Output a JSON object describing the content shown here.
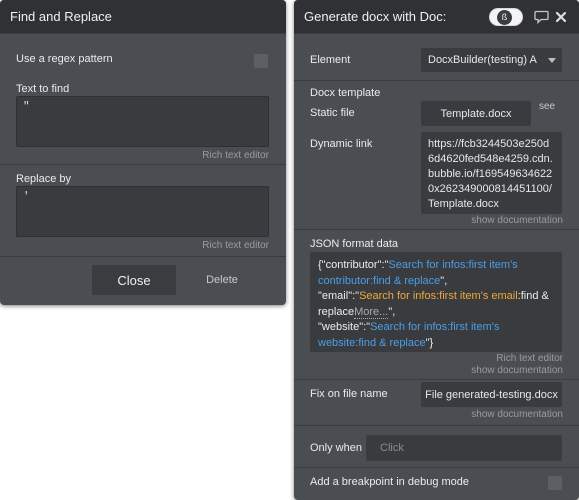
{
  "find_replace": {
    "title": "Find and Replace",
    "regex_label": "Use a regex pattern",
    "regex_checked": false,
    "find_label": "Text to find",
    "find_value": "\"",
    "find_hint": "Rich text editor",
    "replace_label": "Replace by",
    "replace_value": "'",
    "replace_hint": "Rich text editor",
    "close_label": "Close",
    "delete_label": "Delete"
  },
  "generate_docx": {
    "title": "Generate docx with Doc:",
    "avatar_glyph": "ß",
    "element_label": "Element",
    "element_value": "DocxBuilder(testing) A",
    "docx_template_label": "Docx template",
    "static_file_label": "Static file",
    "static_file_value": "Template.docx",
    "see_label": "see",
    "dynamic_link_label": "Dynamic link",
    "dynamic_link_value": "https://fcb3244503e250d6d4620fed548e4259.cdn.bubble.io/f1695496346220x262349000814451100/Template.docx",
    "show_doc_1": "show documentation",
    "json_label": "JSON format data",
    "json": {
      "part1": "{\"contributor\":\"",
      "contributor_expr": "Search for infos:first item's contributor:find & replace",
      "part2": "\",",
      "part3": "\"email\":\"",
      "email_expr": "Search for infos:first item's email",
      "email_suffix": ":find & replace",
      "more": "More...",
      "part4": "\",",
      "part5": "\"website\":\"",
      "website_expr": "Search for infos:first item's website:find & replace",
      "part6": "\"}"
    },
    "json_hint": "Rich text editor",
    "show_doc_2": "show documentation",
    "fix_filename_label": "Fix on file name",
    "fix_filename_value": "File generated-testing.docx",
    "show_doc_3": "show documentation",
    "only_when_label": "Only when",
    "only_when_placeholder": "Click",
    "breakpoint_label": "Add a breakpoint in debug mode",
    "breakpoint_checked": false
  }
}
